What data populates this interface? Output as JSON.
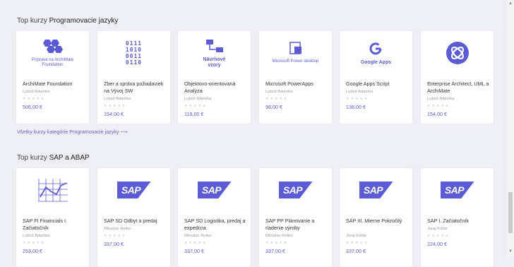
{
  "section1": {
    "title_prefix": "Top kurzy",
    "title_topic": "Programovacie jazyky",
    "more_link": "Všetky kurzy kategórie Programovacie jazyky ⟶",
    "cards": [
      {
        "title": "ArchiMate Foundation",
        "author": "Luboš Adamka",
        "price": "506,00 €",
        "stars": "★★★★★",
        "icon": "archimate-hexagons-icon",
        "thumb_text": "Príprava na ArchiMate Foundation"
      },
      {
        "title": "Zber a správa požiadaviek na Vývoj SW",
        "author": "Luboš Adamka",
        "price": "154,00 €",
        "stars": "★★★★★",
        "icon": "binary-code-icon",
        "thumb_text": "0111\n1010\n0011\n0110"
      },
      {
        "title": "Objektovo-orientovaná Analýza",
        "author": "Luboš Adamka",
        "price": "118,00 €",
        "stars": "★★★★★",
        "icon": "flow-diagram-icon",
        "thumb_text": "Návrhové vzory"
      },
      {
        "title": "Microsoft PowerApps",
        "author": "Luboš Adamka",
        "price": "98,00 €",
        "stars": "★★★★★",
        "icon": "microsoft-powerapps-icon",
        "thumb_text": "Microsoft Power desktop"
      },
      {
        "title": "Google Apps Script",
        "author": "Luboš Adamka",
        "price": "138,00 €",
        "stars": "★★★★★",
        "icon": "google-apps-icon",
        "thumb_text": "Google Apps"
      },
      {
        "title": "Enterprise Architect, UML a ArchiMate",
        "author": "Luboš Adamka",
        "price": "154,00 €",
        "stars": "★★★★★",
        "icon": "enterprise-architect-icon",
        "thumb_text": ""
      }
    ]
  },
  "section2": {
    "title_prefix": "Top kurzy",
    "title_topic": "SAP a ABAP",
    "cards": [
      {
        "title": "SAP FI Financials I. Začiatočník",
        "author": "Luboš Adamka",
        "price": "253,00 €",
        "stars": "★★★★★",
        "icon": "chart-icon",
        "thumb_text": ""
      },
      {
        "title": "SAP SD Odbyt a predaj",
        "author": "Miroslav Reiter",
        "price": "337,00 €",
        "stars": "★★★★★",
        "icon": "sap-logo-icon",
        "thumb_text": "SAP"
      },
      {
        "title": "SAP SD Logistika, predaj a expedícia",
        "author": "Miroslav Reiter",
        "price": "337,00 €",
        "stars": "★★★★★",
        "icon": "sap-logo-icon",
        "thumb_text": "SAP"
      },
      {
        "title": "SAP PP Plánovanie a riadenie výroby",
        "author": "Miroslav Reiter",
        "price": "337,00 €",
        "stars": "★★★★★",
        "icon": "sap-logo-icon",
        "thumb_text": "SAP"
      },
      {
        "title": "SAP III. Mierne Pokročilý",
        "author": "Juraj Kollár",
        "price": "337,00 €",
        "stars": "★★★★★",
        "icon": "sap-logo-icon",
        "thumb_text": "SAP"
      },
      {
        "title": "SAP I. Začiatočník",
        "author": "Juraj Kollár",
        "price": "224,00 €",
        "stars": "★★★★★",
        "icon": "sap-logo-icon",
        "thumb_text": "SAP"
      }
    ]
  },
  "scrollbar": {
    "up": "▲",
    "down": "▼"
  },
  "colors": {
    "accent": "#5b5bd6",
    "background": "#eeeef5",
    "card": "#ffffff"
  }
}
